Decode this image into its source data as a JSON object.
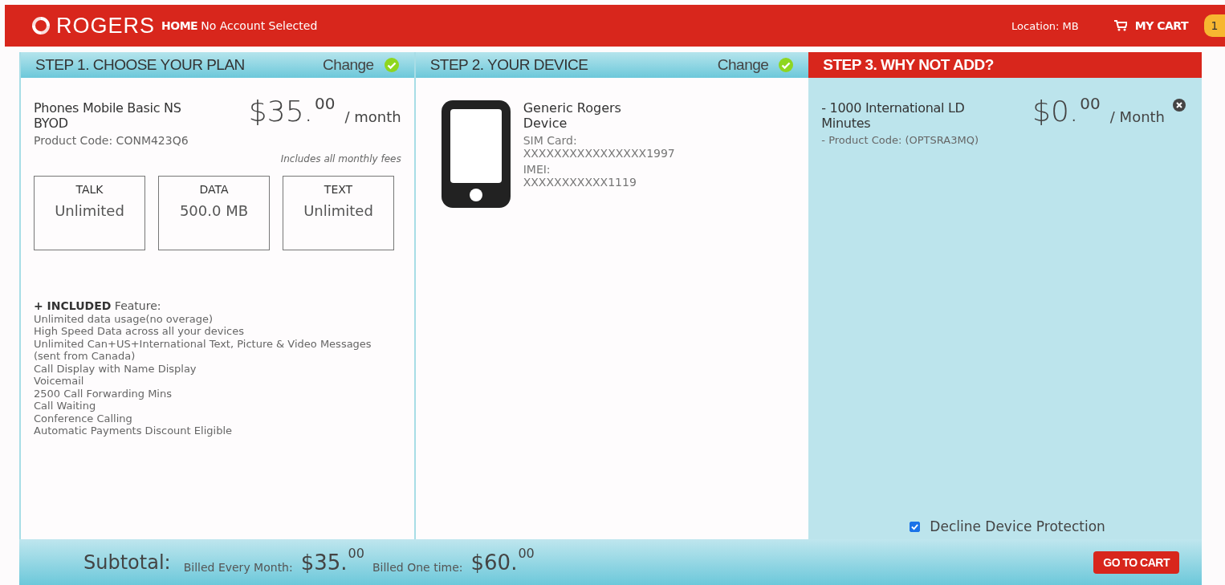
{
  "header": {
    "logo": "ROGERS",
    "home": "HOME",
    "account": "No Account Selected",
    "location": "Location: MB",
    "cart": "MY CART",
    "cart_count": "1"
  },
  "steps": [
    {
      "kind": "plan",
      "title": "STEP 1. CHOOSE YOUR PLAN",
      "change": "Change",
      "done": true,
      "selected": false,
      "plan_name": "Phones Mobile Basic NS BYOD",
      "product_code": "Product Code: CONM423Q6",
      "price": "$35.",
      "cents": "00",
      "period": "/ month",
      "note": "Includes all monthly fees",
      "allowances": [
        {
          "label": "TALK",
          "value": "Unlimited"
        },
        {
          "label": "DATA",
          "value": "500.0 MB"
        },
        {
          "label": "TEXT",
          "value": "Unlimited"
        }
      ],
      "features_title": "**+ INCLUDED** Feature:",
      "features": [
        "Unlimited data usage(no overage)",
        "High Speed Data across all your devices",
        "Unlimited Can+US+International Text, Picture & Video Messages (sent from Canada)",
        "Call Display with Name Display",
        "Voicemail",
        "2500 Call Forwarding Mins",
        "Call Waiting",
        "Conference Calling",
        "Automatic Payments Discount Eligible"
      ]
    },
    {
      "kind": "device",
      "title": "STEP 2. YOUR DEVICE",
      "change": "Change",
      "done": true,
      "selected": false,
      "device_name": "Generic Rogers Device",
      "sim_label": "SIM Card:",
      "sim": "XXXXXXXXXXXXXXXX1997",
      "imei_label": "IMEI:",
      "imei": "XXXXXXXXXXX1119"
    },
    {
      "kind": "addon",
      "title": "STEP 3. WHY NOT ADD?",
      "selected": true,
      "addon_name": "- 1000 International LD Minutes",
      "product_code": "- Product Code: (OPTSRA3MQ)",
      "price": "$0.",
      "cents": "00",
      "period": "/ Month",
      "decline_label": "Decline Device Protection",
      "decline_checked": true
    }
  ],
  "footer": {
    "subtotal": "Subtotal:",
    "monthly_label": "Billed Every Month:",
    "monthly_price": "$35.",
    "monthly_cents": "00",
    "onetime_label": "Billed One time:",
    "onetime_price": "$60.",
    "onetime_cents": "00",
    "button": "GO TO CART"
  }
}
